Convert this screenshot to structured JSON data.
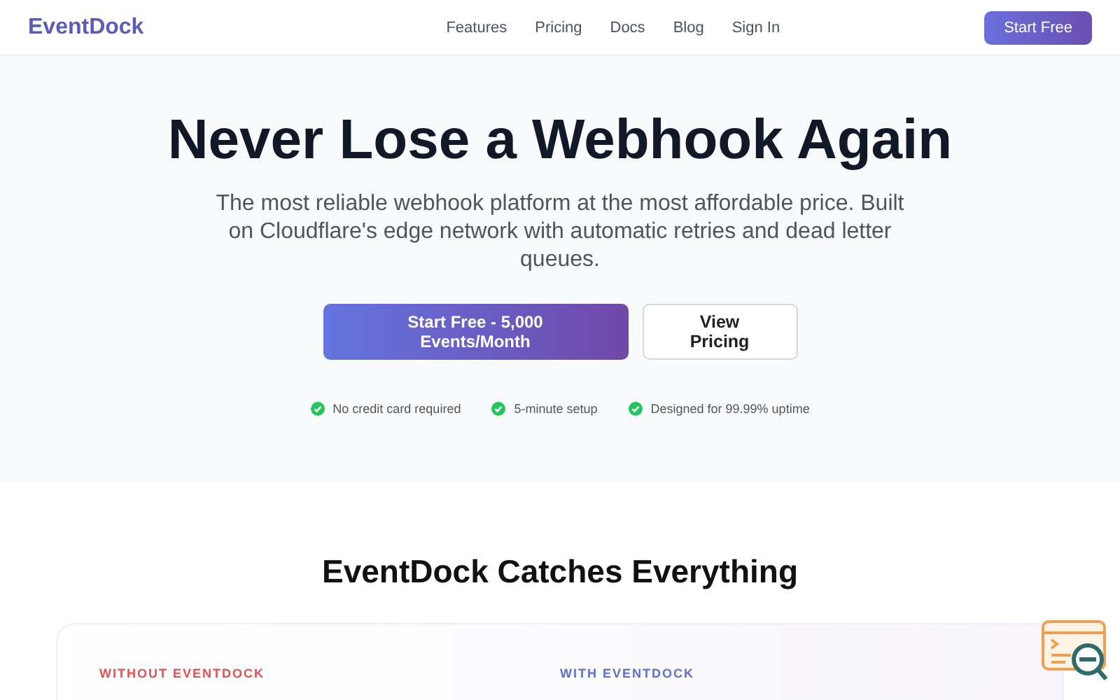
{
  "header": {
    "logo": "EventDock",
    "nav": [
      "Features",
      "Pricing",
      "Docs",
      "Blog",
      "Sign In"
    ],
    "cta": "Start Free"
  },
  "hero": {
    "title": "Never Lose a Webhook Again",
    "subtitle": "The most reliable webhook platform at the most affordable price. Built on Cloudflare's edge network with automatic retries and dead letter queues.",
    "buttons": [
      {
        "label": "Start Free - 5,000 Events/Month",
        "kind": "primary"
      },
      {
        "label": "View Pricing",
        "kind": "secondary"
      }
    ],
    "features": [
      "No credit card required",
      "5-minute setup",
      "Designed for 99.99% uptime"
    ]
  },
  "comparison": {
    "title": "EventDock Catches Everything",
    "columns": [
      {
        "label": "WITHOUT EVENTDOCK",
        "kind": "without"
      },
      {
        "label": "WITH EVENTDOCK",
        "kind": "with"
      }
    ]
  }
}
